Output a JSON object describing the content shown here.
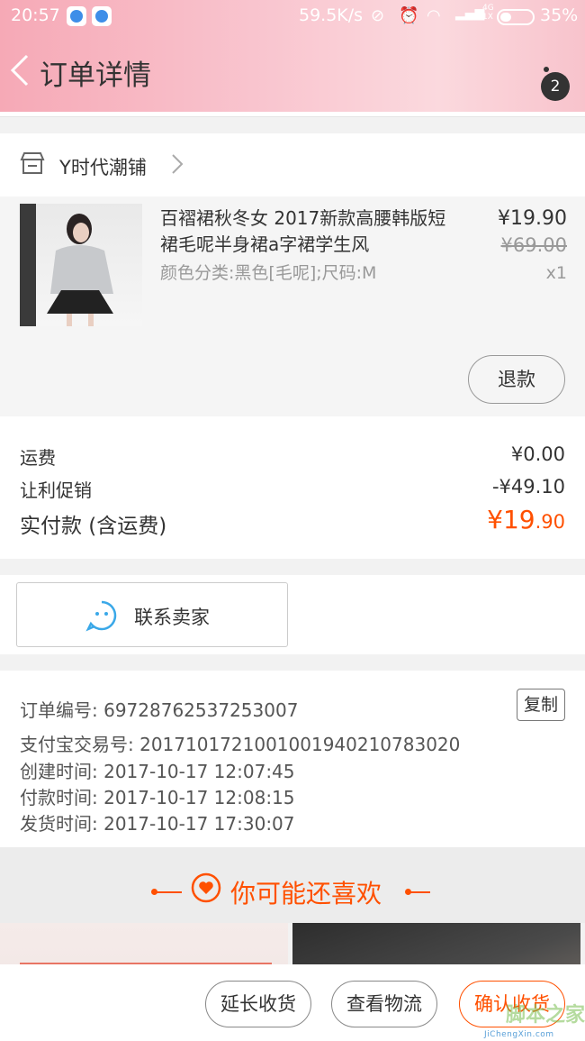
{
  "status_bar": {
    "time": "20:57",
    "net_speed": "59.5K/s",
    "network": "4G",
    "network_sub": "1X",
    "battery": "35%"
  },
  "header": {
    "title": "订单详情",
    "notification_count": "2"
  },
  "shop": {
    "name": "Y时代潮铺"
  },
  "item": {
    "title": "百褶裙秋冬女 2017新款高腰韩版短裙毛呢半身裙a字裙学生风",
    "spec": "颜色分类:黑色[毛呢];尺码:M",
    "price": "¥19.90",
    "original_price": "¥69.00",
    "quantity": "x1",
    "refund_label": "退款"
  },
  "fees": {
    "shipping_label": "运费",
    "shipping_value": "¥0.00",
    "discount_label": "让利促销",
    "discount_value": "-¥49.10",
    "total_label": "实付款 (含运费)",
    "total_currency": "¥",
    "total_int": "19",
    "total_dec": ".90"
  },
  "contact": {
    "label": "联系卖家"
  },
  "order_info": {
    "order_no": "订单编号: 69728762537253007",
    "alipay_no": "支付宝交易号: 2017101721001001940210783020",
    "created": "创建时间: 2017-10-17 12:07:45",
    "paid": "付款时间: 2017-10-17 12:08:15",
    "shipped": "发货时间: 2017-10-17 17:30:07",
    "copy_label": "复制"
  },
  "recommend": {
    "title": "你可能还喜欢"
  },
  "bottom_bar": {
    "extend_label": "延长收货",
    "logistics_label": "查看物流",
    "confirm_label": "确认收货"
  },
  "watermark": {
    "text": "脚本之家",
    "sub": "JiChengXin.com"
  },
  "colors": {
    "accent": "#ff5000",
    "header_gradient": [
      "#f6a9b6",
      "#fbd9de"
    ]
  }
}
